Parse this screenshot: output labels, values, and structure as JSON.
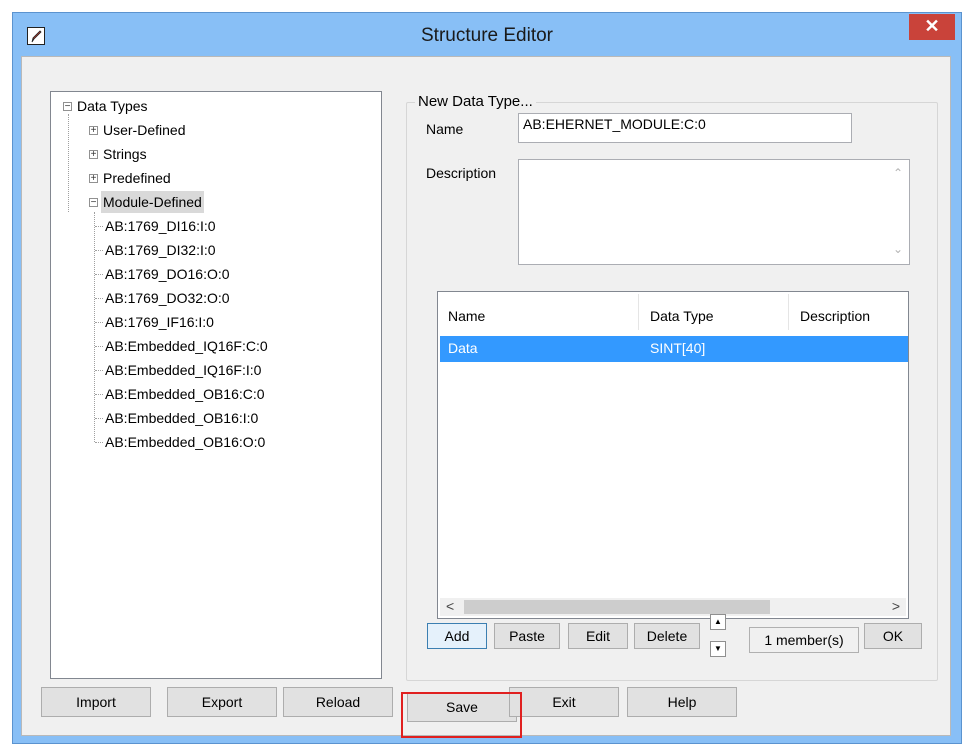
{
  "window": {
    "title": "Structure Editor",
    "close_glyph": "✕"
  },
  "tree": {
    "root": "Data Types",
    "categories": [
      "User-Defined",
      "Strings",
      "Predefined",
      "Module-Defined"
    ],
    "module_items": [
      "AB:1769_DI16:I:0",
      "AB:1769_DI32:I:0",
      "AB:1769_DO16:O:0",
      "AB:1769_DO32:O:0",
      "AB:1769_IF16:I:0",
      "AB:Embedded_IQ16F:C:0",
      "AB:Embedded_IQ16F:I:0",
      "AB:Embedded_OB16:C:0",
      "AB:Embedded_OB16:I:0",
      "AB:Embedded_OB16:O:0"
    ]
  },
  "group": {
    "title": "New Data Type...",
    "name_label": "Name",
    "name_value": "AB:EHERNET_MODULE:C:0",
    "description_label": "Description",
    "description_value": ""
  },
  "members_table": {
    "columns": [
      "Name",
      "Data Type",
      "Description"
    ],
    "rows": [
      {
        "name": "Data",
        "data_type": "SINT[40]",
        "description": ""
      }
    ]
  },
  "member_buttons": {
    "add": "Add",
    "paste": "Paste",
    "edit": "Edit",
    "delete": "Delete",
    "member_count": "1 member(s)",
    "ok": "OK"
  },
  "bottom_buttons": {
    "import": "Import",
    "export": "Export",
    "reload": "Reload",
    "save": "Save",
    "exit": "Exit",
    "help": "Help"
  },
  "colors": {
    "title_bar": "#88bff6",
    "close_button": "#c9433a",
    "selection": "#3399ff",
    "highlight_box": "#e02020"
  },
  "icons": {
    "app": "pencil-icon",
    "close": "close-icon",
    "expand": "plus-box-icon",
    "collapse": "minus-box-icon",
    "scroll_left": "chevron-left-icon",
    "scroll_right": "chevron-right-icon",
    "spin_up": "triangle-up-icon",
    "spin_down": "triangle-down-icon"
  }
}
